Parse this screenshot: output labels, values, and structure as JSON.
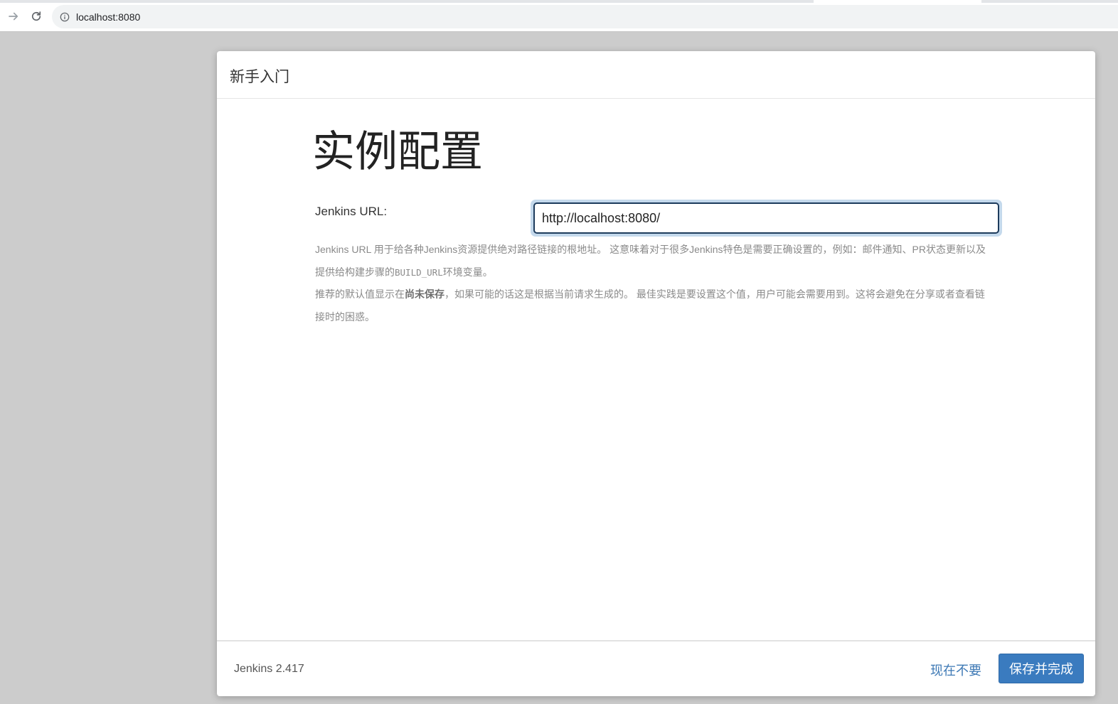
{
  "browser": {
    "url": "localhost:8080"
  },
  "dialog": {
    "title": "新手入门",
    "heading": "实例配置",
    "field_label": "Jenkins URL:",
    "url_value": "http://localhost:8080/",
    "help": {
      "line1_before_code": "Jenkins URL 用于给各种Jenkins资源提供绝对路径链接的根地址。 这意味着对于很多Jenkins特色是需要正确设置的，例如：邮件通知、PR状态更新以及提供给构建步骤的",
      "code": "BUILD_URL",
      "line1_after_code": "环境变量。",
      "line2_before_bold": "推荐的默认值显示在",
      "bold": "尚未保存",
      "line2_after_bold": "，如果可能的话这是根据当前请求生成的。 最佳实践是要设置这个值，用户可能会需要用到。这将会避免在分享或者查看链接时的困惑。"
    },
    "footer": {
      "version": "Jenkins 2.417",
      "skip_label": "现在不要",
      "save_label": "保存并完成"
    }
  },
  "colors": {
    "primary_button": "#3a7bbf",
    "link": "#3e79b5",
    "backdrop": "#cccccc"
  }
}
